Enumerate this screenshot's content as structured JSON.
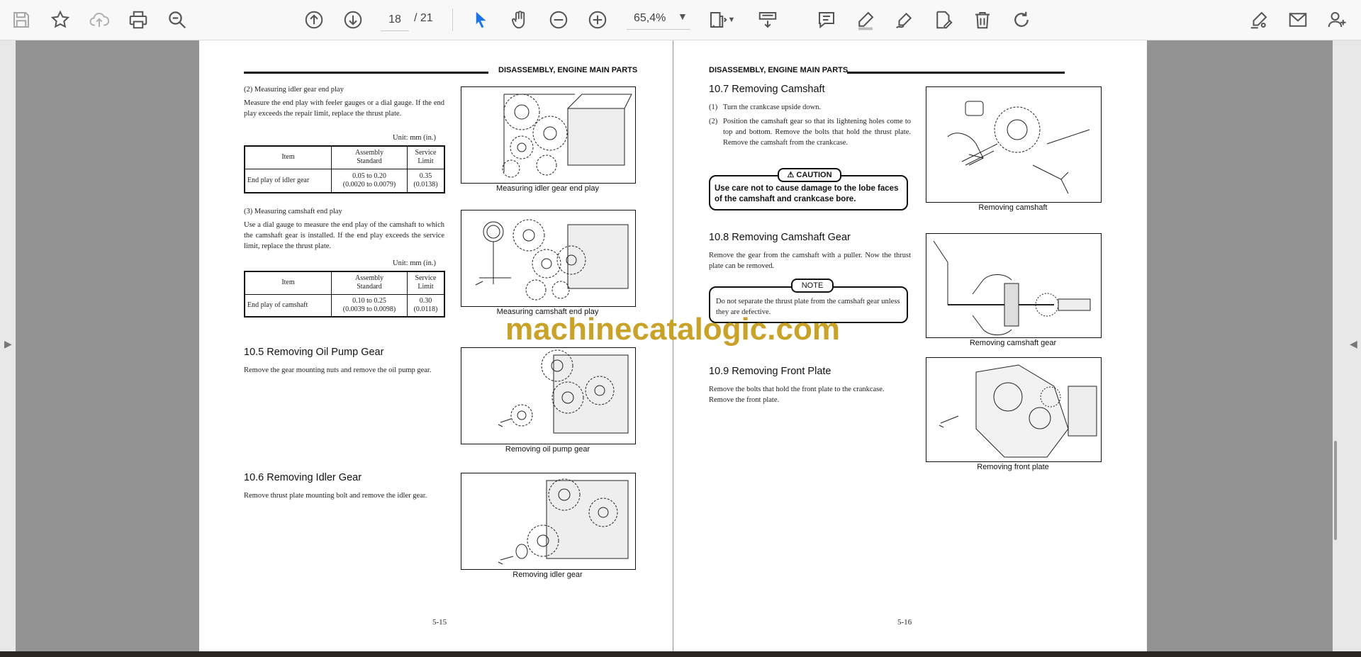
{
  "toolbar": {
    "page_current": "18",
    "page_total": "/ 21",
    "zoom": "65,4%"
  },
  "left_page": {
    "header": "DISASSEMBLY, ENGINE MAIN PARTS",
    "s2_title": "(2)  Measuring idler gear end play",
    "s2_body": "Measure the end play with feeler gauges or a dial gauge. If the end play exceeds the repair limit, replace the thrust plate.",
    "unit1": "Unit:  mm (in.)",
    "table1": {
      "h_item": "Item",
      "h_assembly_1": "Assembly",
      "h_assembly_2": "Standard",
      "h_service_1": "Service",
      "h_service_2": "Limit",
      "row_item": "End play of idler gear",
      "row_std_1": "0.05 to 0.20",
      "row_std_2": "(0.0020 to 0.0079)",
      "row_lim_1": "0.35",
      "row_lim_2": "(0.0138)"
    },
    "fig1_caption": "Measuring idler gear end play",
    "s3_title": "(3)  Measuring camshaft end play",
    "s3_body": "Use a dial gauge to measure the end play of the camshaft to which the camshaft gear is installed. If the end play exceeds the service limit, replace the thrust plate.",
    "unit2": "Unit:  mm (in.)",
    "table2": {
      "h_item": "Item",
      "h_assembly_1": "Assembly",
      "h_assembly_2": "Standard",
      "h_service_1": "Service",
      "h_service_2": "Limit",
      "row_item": "End play of camshaft",
      "row_std_1": "0.10 to 0.25",
      "row_std_2": "(0.0039 to 0.0098)",
      "row_lim_1": "0.30",
      "row_lim_2": "(0.0118)"
    },
    "fig2_caption": "Measuring camshaft end play",
    "s105_title": "10.5 Removing Oil Pump Gear",
    "s105_body": "Remove the gear mounting nuts and remove the oil pump gear.",
    "fig3_caption": "Removing oil pump gear",
    "s106_title": "10.6 Removing Idler Gear",
    "s106_body": "Remove thrust plate mounting bolt and remove the idler gear.",
    "fig4_caption": "Removing idler gear",
    "page_number": "5-15"
  },
  "right_page": {
    "header": "DISASSEMBLY, ENGINE MAIN PARTS",
    "s107_title": "10.7 Removing Camshaft",
    "s107_step1_num": "(1)",
    "s107_step1": "Turn the crankcase upside down.",
    "s107_step2_num": "(2)",
    "s107_step2": "Position the camshaft gear so that its lightening holes come to top and bottom.  Remove the bolts that hold the thrust plate.  Remove the camshaft from the crankcase.",
    "caution_label": "CAUTION",
    "caution_text": "Use care not to cause damage to the lobe faces of the camshaft and crankcase bore.",
    "fig5_caption": "Removing camshaft",
    "s108_title": "10.8 Removing Camshaft Gear",
    "s108_body": "Remove the gear from the camshaft with a puller. Now the thrust plate can be removed.",
    "note_label": "NOTE",
    "note_text": "Do not separate the thrust plate from the camshaft gear unless they are defective.",
    "fig6_caption": "Removing camshaft gear",
    "s109_title": "10.9 Removing Front Plate",
    "s109_body": "Remove the bolts that hold the front plate to the crankcase. Remove the front plate.",
    "fig7_caption": "Removing front plate",
    "page_number": "5-16"
  },
  "watermark": "machinecatalogic.com",
  "colors": {
    "accent": "#1a73e8",
    "watermark": "#c9a22a"
  }
}
